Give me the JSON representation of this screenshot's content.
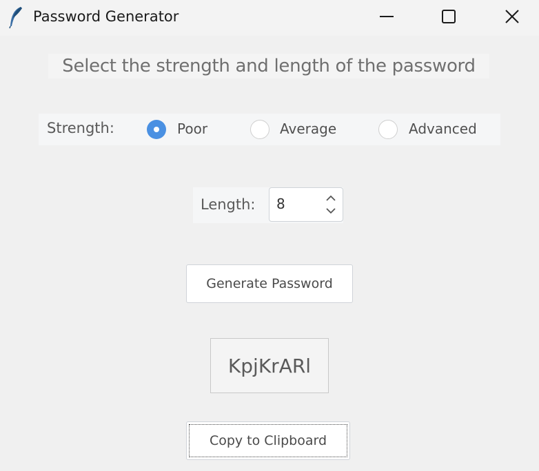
{
  "window": {
    "title": "Password Generator",
    "icon": "feather-icon"
  },
  "window_controls": {
    "minimize_icon": "minimize-icon",
    "maximize_icon": "maximize-icon",
    "close_icon": "close-icon"
  },
  "header": {
    "text": "Select the strength and length of the password"
  },
  "strength": {
    "label": "Strength:",
    "options": [
      {
        "label": "Poor",
        "selected": true
      },
      {
        "label": "Average",
        "selected": false
      },
      {
        "label": "Advanced",
        "selected": false
      }
    ],
    "selected_color": "#4a90e2"
  },
  "length": {
    "label": "Length:",
    "value": "8"
  },
  "actions": {
    "generate_label": "Generate Password",
    "copy_label": "Copy to Clipboard"
  },
  "password": {
    "value": "KpjKrARl"
  }
}
